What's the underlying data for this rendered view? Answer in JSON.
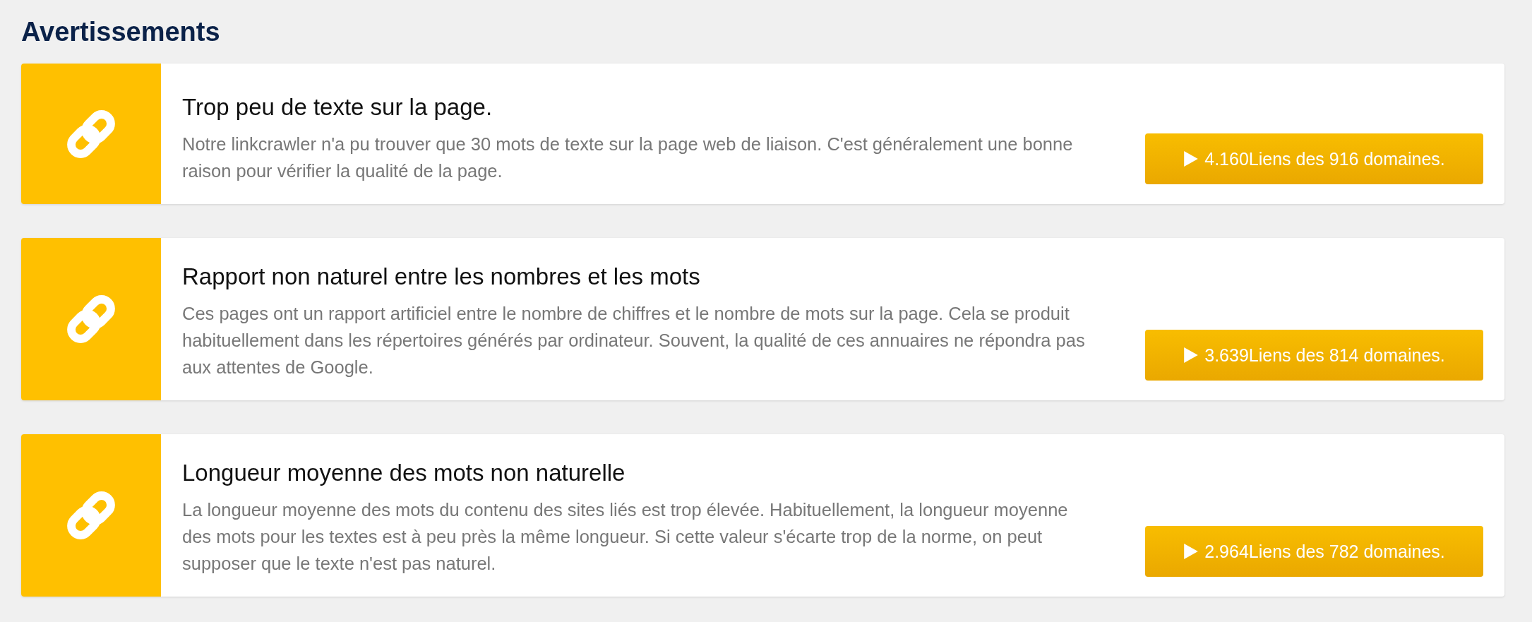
{
  "heading": "Avertissements",
  "warnings": [
    {
      "title": "Trop peu de texte sur la page.",
      "description": "Notre linkcrawler n'a pu trouver que 30 mots de texte sur la page web de liaison. C'est généralement une bonne raison pour vérifier la qualité de la page.",
      "button": "4.160Liens des 916 domaines."
    },
    {
      "title": "Rapport non naturel entre les nombres et les mots",
      "description": "Ces pages ont un rapport artificiel entre le nombre de chiffres et le nombre de mots sur la page. Cela se produit habituellement dans les répertoires générés par ordinateur. Souvent, la qualité de ces annuaires ne répondra pas aux attentes de Google.",
      "button": "3.639Liens des 814 domaines."
    },
    {
      "title": "Longueur moyenne des mots non naturelle",
      "description": "La longueur moyenne des mots du contenu des sites liés est trop élevée. Habituellement, la longueur moyenne des mots pour les textes est à peu près la même longueur. Si cette valeur s'écarte trop de la norme, on peut supposer que le texte n'est pas naturel.",
      "button": "2.964Liens des 782 domaines."
    }
  ]
}
